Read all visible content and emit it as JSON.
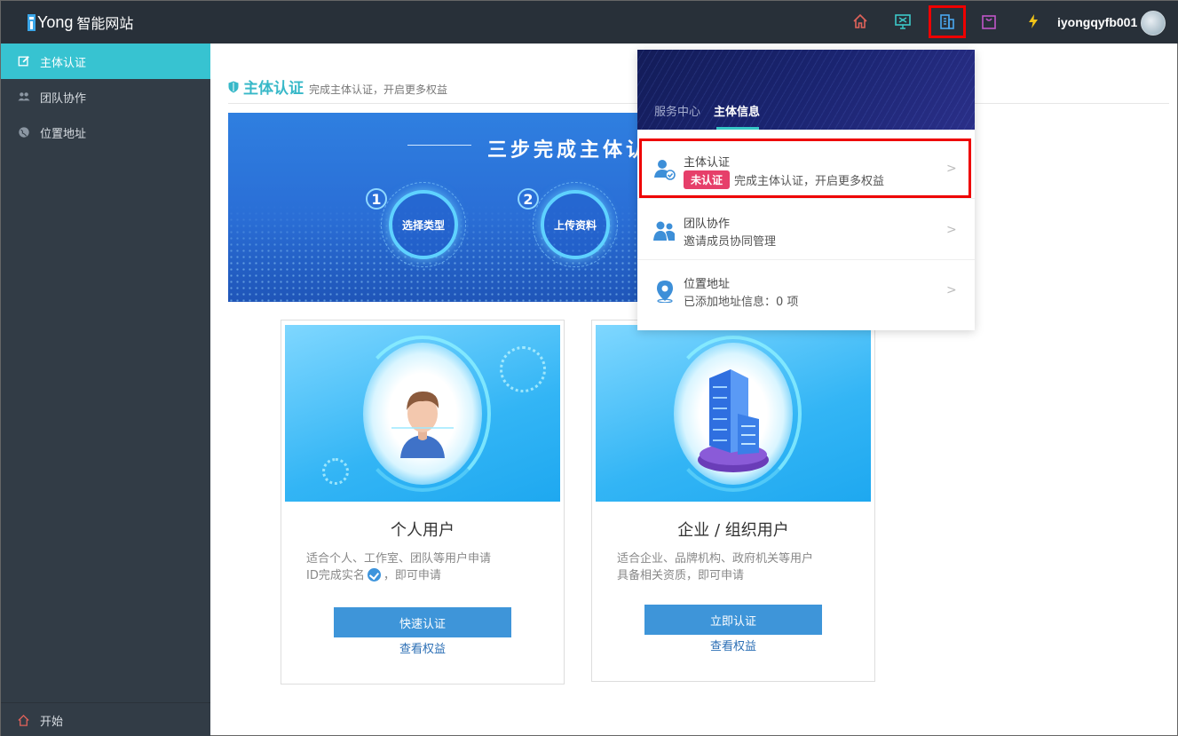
{
  "app": {
    "logo_text": "Yong 智能网站",
    "logo_brand": "Yong",
    "logo_cn": "智能网站"
  },
  "topbar": {
    "icons": [
      "home-icon",
      "monitor-icon",
      "building-icon",
      "shopping-bag-icon",
      "lightning-icon"
    ],
    "username": "iyongqyfb001"
  },
  "sidebar": {
    "items": [
      {
        "label": "主体认证",
        "icon": "edit-icon",
        "active": true
      },
      {
        "label": "团队协作",
        "icon": "users-icon",
        "active": false
      },
      {
        "label": "位置地址",
        "icon": "globe-icon",
        "active": false
      }
    ],
    "bottom_label": "开始"
  },
  "main": {
    "title": "主体认证",
    "subtitle": "完成主体认证，开启更多权益",
    "banner": {
      "title": "三步完成主体认",
      "steps": [
        {
          "num": "1",
          "label": "选择类型"
        },
        {
          "num": "2",
          "label": "上传资料"
        }
      ]
    },
    "cards": [
      {
        "title": "个人用户",
        "desc_line1": "适合个人、工作室、团队等用户申请",
        "desc_line2a": "ID完成实名",
        "desc_line2b": "，即可申请",
        "button": "快速认证",
        "link": "查看权益"
      },
      {
        "title": "企业 / 组织用户",
        "desc_line1": "适合企业、品牌机构、政府机关等用户",
        "desc_line2a": "具备相关资质，即可申请",
        "button": "立即认证",
        "link": "查看权益"
      }
    ]
  },
  "dropdown": {
    "tabs": [
      "服务中心",
      "主体信息"
    ],
    "items": [
      {
        "title": "主体认证",
        "badge": "未认证",
        "sub": "完成主体认证，开启更多权益",
        "icon": "user-verified-icon"
      },
      {
        "title": "团队协作",
        "sub": "邀请成员协同管理",
        "icon": "team-icon"
      },
      {
        "title": "位置地址",
        "sub": "已添加地址信息：0 项",
        "icon": "location-pin-icon"
      }
    ],
    "arrow": ">"
  },
  "colors": {
    "topbar": "#283039",
    "sidebar": "#323c46",
    "accent": "#37c3d1",
    "button": "#3e95d9",
    "badge": "#e63f6a",
    "highlight": "#ee0000"
  }
}
